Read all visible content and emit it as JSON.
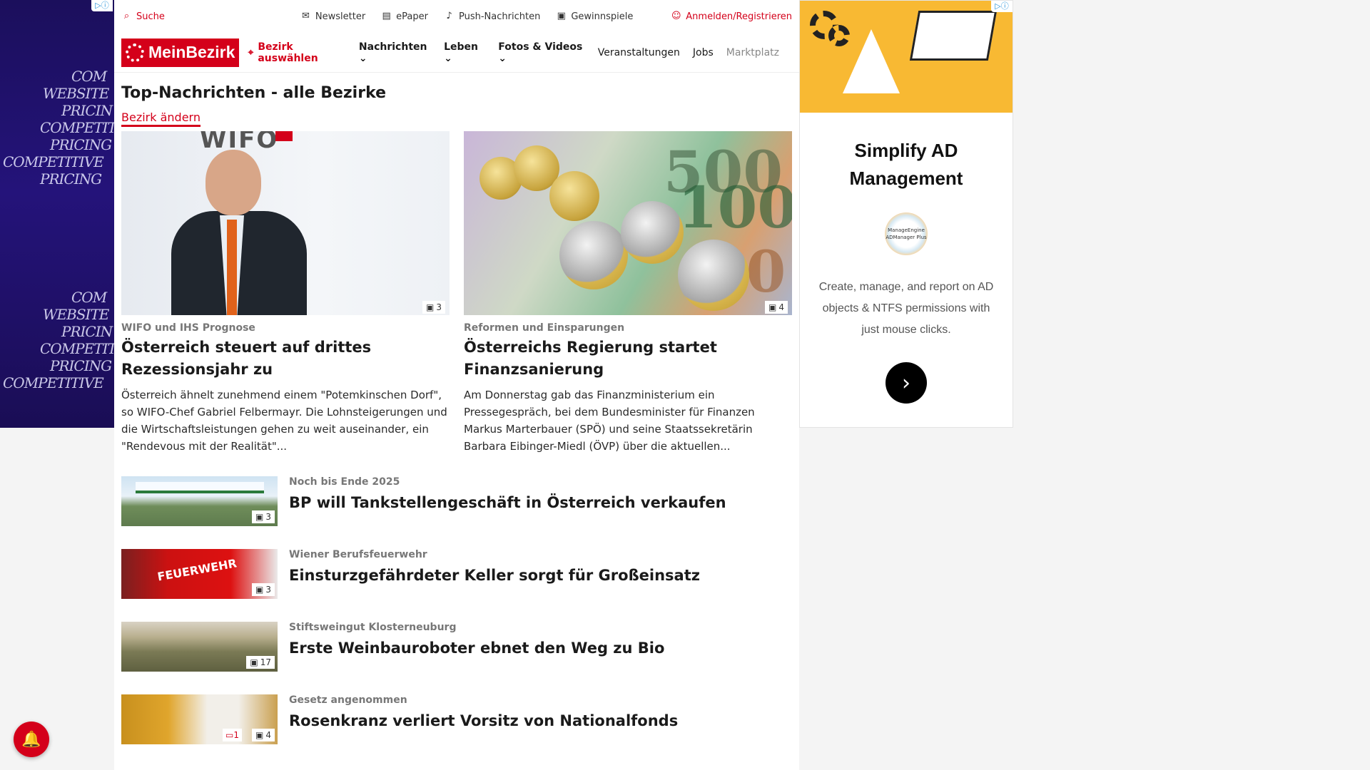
{
  "topbar": {
    "search": "Suche",
    "newsletter": "Newsletter",
    "epaper": "ePaper",
    "push": "Push-Nachrichten",
    "gewinnspiele": "Gewinnspiele",
    "login": "Anmelden/Registrieren"
  },
  "nav": {
    "logo": "MeinBezirk",
    "bezirk": "Bezirk auswählen",
    "items": [
      {
        "label": "Nachrichten"
      },
      {
        "label": "Leben"
      },
      {
        "label": "Fotos & Videos"
      },
      {
        "label": "Veranstaltungen"
      },
      {
        "label": "Jobs"
      },
      {
        "label": "Marktplatz"
      }
    ]
  },
  "main": {
    "heading": "Top-Nachrichten - alle Bezirke",
    "change_link": "Bezirk ändern",
    "cards": [
      {
        "image_count": "3",
        "kicker": "WIFO und IHS Prognose",
        "title": "Österreich steuert auf drittes Rezessionsjahr zu",
        "teaser": "Österreich ähnelt zunehmend einem \"Potemkinschen Dorf\", so WIFO-Chef Gabriel Felbermayr. Die Lohnsteigerungen und die Wirtschaftsleistungen gehen zu weit auseinander, ein \"Rendevous mit der Realität\"..."
      },
      {
        "image_count": "4",
        "kicker": "Reformen und Einsparungen",
        "title": "Österreichs Regierung startet Finanzsanierung",
        "teaser": "Am Donnerstag gab das Finanzministerium ein Pressegespräch, bei dem Bundesminister für Finanzen Markus Marterbauer (SPÖ) und seine Staatssekretärin Barbara Eibinger-Miedl (ÖVP) über die aktuellen..."
      }
    ],
    "list": [
      {
        "kicker": "Noch bis Ende 2025",
        "title": "BP will Tankstellengeschäft in Österreich verkaufen",
        "image_count": "3"
      },
      {
        "kicker": "Wiener Berufsfeuerwehr",
        "title": "Einsturzgefährdeter Keller sorgt für Großeinsatz",
        "image_count": "3",
        "thumb_text": "FEUERWEHR"
      },
      {
        "kicker": "Stiftsweingut Klosterneuburg",
        "title": "Erste Weinbauroboter ebnet den Weg zu Bio",
        "image_count": "17"
      },
      {
        "kicker": "Gesetz angenommen",
        "title": "Rosenkranz verliert Vorsitz von Nationalfonds",
        "image_count": "4",
        "comment_count": "1"
      }
    ]
  },
  "ad_right": {
    "title": "Simplify AD Management",
    "logo_text": "ManageEngine ADManager Plus",
    "text": "Create, manage, and report on AD objects & NTFS permissions with just mouse clicks."
  },
  "ad_left": {
    "lines": [
      "COM",
      "WEBSITE",
      "PRICIN",
      "COMPETITIVE",
      "PRICING",
      "COMPETITIVE",
      "PRICING"
    ]
  },
  "icons": {
    "search": "search-icon",
    "mail": "mail-icon",
    "newspaper": "newspaper-icon",
    "bell": "bell-icon",
    "gift": "gift-icon",
    "user": "user-icon",
    "pin": "location-pin-icon",
    "camera": "gallery-icon"
  },
  "colors": {
    "brand": "#d4001a",
    "ad_left_bg": "#1b0f5c",
    "ad_banner": "#f8b933"
  }
}
